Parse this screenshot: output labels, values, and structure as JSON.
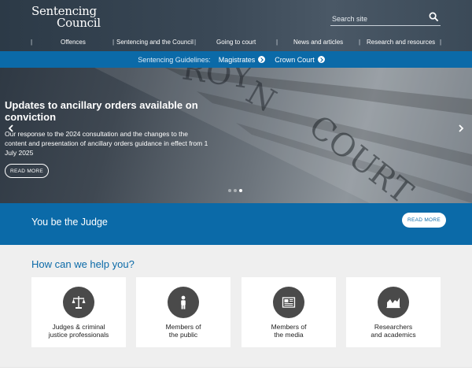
{
  "header": {
    "logo": {
      "line1": "Sentencing",
      "line2": "Council"
    },
    "search": {
      "placeholder": "Search site",
      "icon": "search-icon"
    },
    "nav": [
      {
        "label": "Offences"
      },
      {
        "label": "Sentencing and the Council"
      },
      {
        "label": "Going to court"
      },
      {
        "label": "News and articles"
      },
      {
        "label": "Research and resources"
      }
    ],
    "separator": "|"
  },
  "guidelines_bar": {
    "label": "Sentencing Guidelines:",
    "links": [
      {
        "label": "Magistrates",
        "icon": "chevron-right-circle-icon"
      },
      {
        "label": "Crown Court",
        "icon": "chevron-right-circle-icon"
      }
    ]
  },
  "hero": {
    "title": "Updates to ancillary orders available on conviction",
    "body": "Our response to the 2024 consultation and the changes to the content and presentation of ancillary orders guidance in effect from 1 July 2025",
    "button_label": "Read more",
    "slides": 3,
    "active_slide": 3
  },
  "judge_band": {
    "title": "You be the Judge",
    "button_label": "Read more"
  },
  "help": {
    "title": "How can we help you?",
    "cards": [
      {
        "label": "Judges & criminal\njustice professionals",
        "icon": "scales-icon"
      },
      {
        "label": "Members of\nthe public",
        "icon": "person-icon"
      },
      {
        "label": "Members of\nthe media",
        "icon": "newspaper-icon"
      },
      {
        "label": "Researchers\nand academics",
        "icon": "chart-icon"
      }
    ]
  },
  "colors": {
    "brand_blue": "#0b6aa8",
    "header_dark": "#2a3744",
    "icon_circle": "#4a4a4a",
    "section_bg": "#efefef"
  }
}
